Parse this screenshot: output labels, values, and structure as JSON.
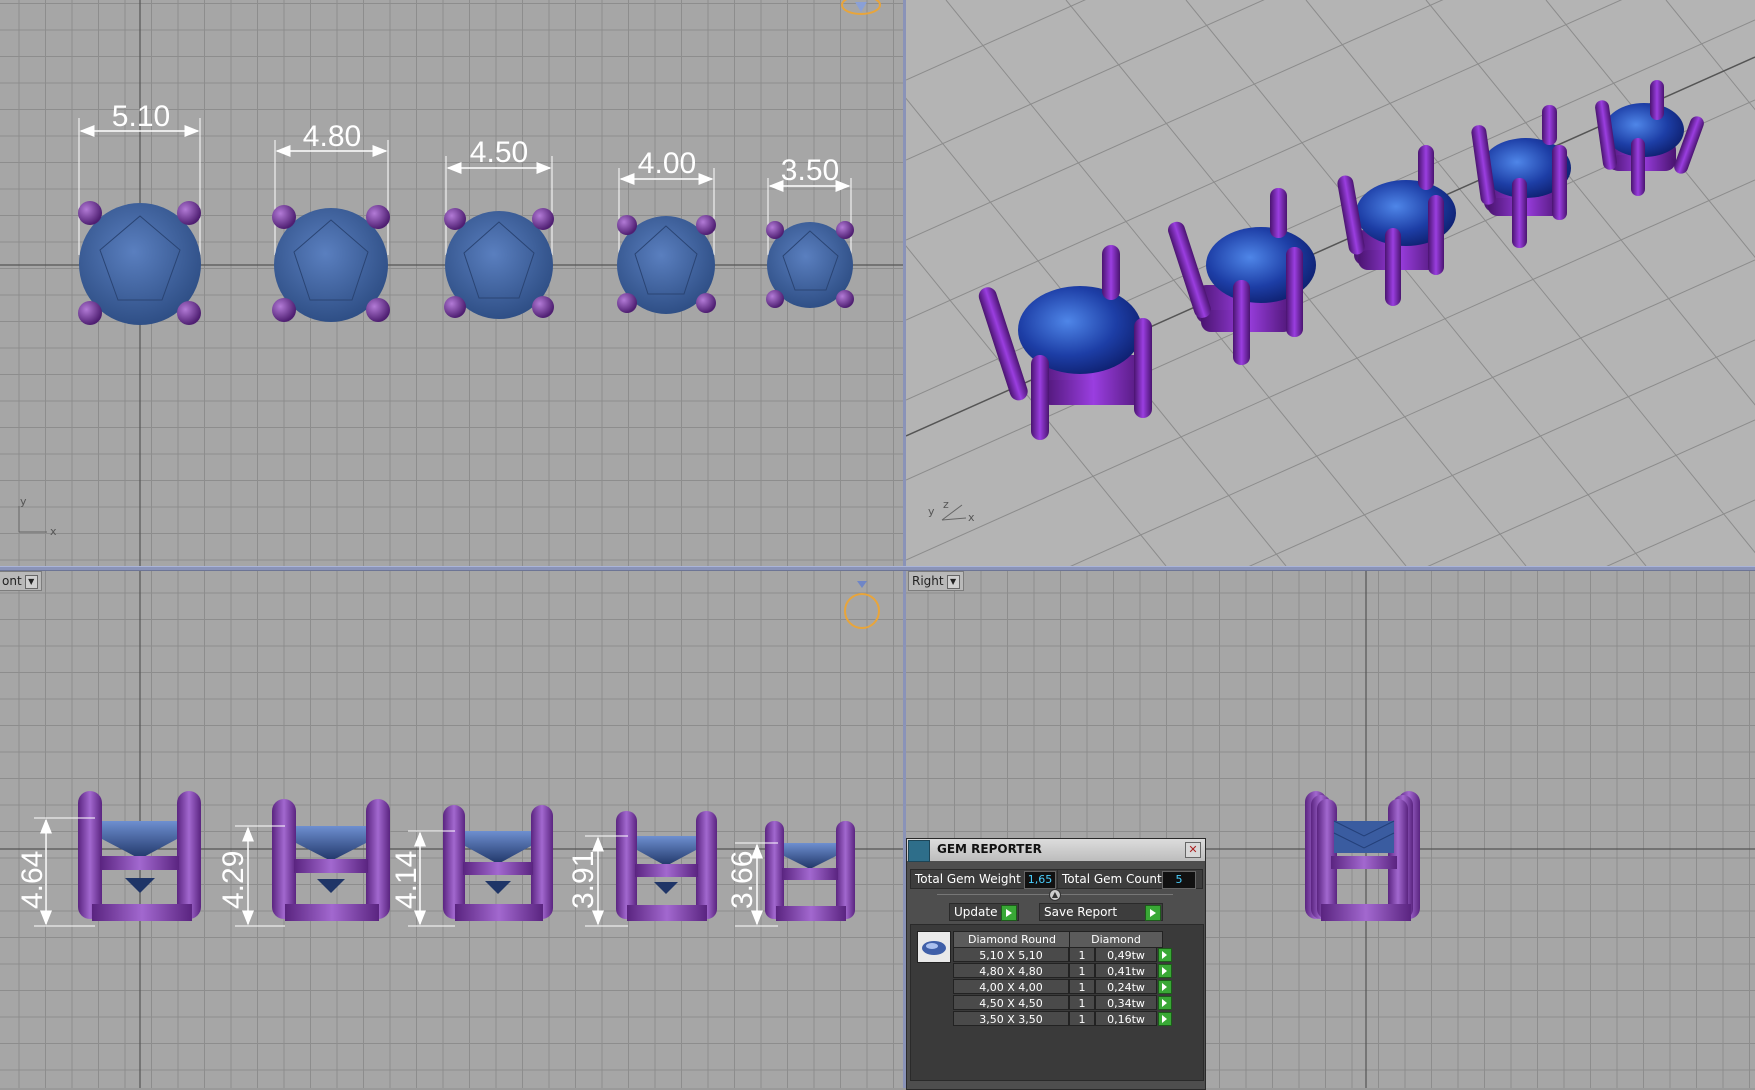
{
  "viewports": {
    "top": {
      "label": ""
    },
    "front": {
      "label": "ont"
    },
    "right": {
      "label": "Right"
    }
  },
  "axes": {
    "top_y": "y",
    "top_x": "x",
    "persp_y": "y",
    "persp_z": "z",
    "persp_x": "x"
  },
  "top_dimensions": [
    "5.10",
    "4.80",
    "4.50",
    "4.00",
    "3.50"
  ],
  "front_dimensions": [
    "4.64",
    "4.29",
    "4.14",
    "3.91",
    "3.66"
  ],
  "gem_reporter": {
    "title": "GEM REPORTER",
    "close_symbol": "✕",
    "total_weight_label": "Total Gem Weight",
    "total_weight_value": "1,65",
    "total_count_label": "Total Gem Count",
    "total_count_value": "5",
    "update_label": "Update",
    "save_report_label": "Save Report",
    "columns": [
      "Diamond Round",
      "Diamond"
    ],
    "rows": [
      {
        "size": "5,10 X 5,10",
        "qty": "1",
        "weight": "0,49tw"
      },
      {
        "size": "4,80 X 4,80",
        "qty": "1",
        "weight": "0,41tw"
      },
      {
        "size": "4,00 X 4,00",
        "qty": "1",
        "weight": "0,24tw"
      },
      {
        "size": "4,50 X 4,50",
        "qty": "1",
        "weight": "0,34tw"
      },
      {
        "size": "3,50 X 3,50",
        "qty": "1",
        "weight": "0,16tw"
      }
    ]
  },
  "colors": {
    "metal": "#7b3aa2",
    "gem": "#3d5f9a",
    "gem_bright": "#1e3fa0",
    "grid": "#8d8d8d"
  }
}
